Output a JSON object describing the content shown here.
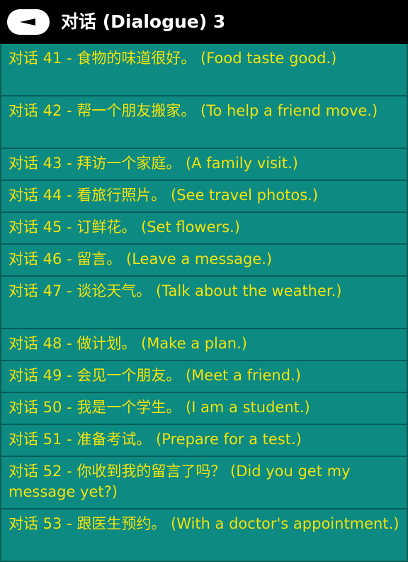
{
  "header": {
    "title": "对话 (Dialogue) 3"
  },
  "items": [
    {
      "label": "对话 41 - 食物的味道很好。 (Food taste good.)"
    },
    {
      "label": "对话 42 - 帮一个朋友搬家。 (To help a friend move.)"
    },
    {
      "label": "对话 43 - 拜访一个家庭。 (A family visit.)"
    },
    {
      "label": "对话 44 - 看旅行照片。 (See travel photos.)"
    },
    {
      "label": "对话 45 - 订鲜花。 (Set flowers.)"
    },
    {
      "label": "对话 46 - 留言。 (Leave a message.)"
    },
    {
      "label": "对话 47 - 谈论天气。 (Talk about the weather.)"
    },
    {
      "label": "对话 48 - 做计划。 (Make a plan.)"
    },
    {
      "label": "对话 49 - 会见一个朋友。 (Meet a friend.)"
    },
    {
      "label": "对话 50 - 我是一个学生。 (I am a student.)"
    },
    {
      "label": "对话 51 - 准备考试。 (Prepare for a test.)"
    },
    {
      "label": "对话 52 - 你收到我的留言了吗？ (Did you get my message yet?)"
    },
    {
      "label": "对话 53 - 跟医生预约。 (With a doctor's appointment.)"
    }
  ]
}
